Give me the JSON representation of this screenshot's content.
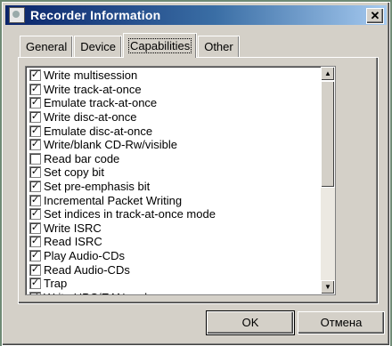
{
  "window": {
    "title": "Recorder Information",
    "close_label": "✕"
  },
  "tabs": [
    "General",
    "Device",
    "Capabilities",
    "Other"
  ],
  "active_tab": 2,
  "capabilities": [
    {
      "label": "Write multisession",
      "checked": true
    },
    {
      "label": "Write track-at-once",
      "checked": true
    },
    {
      "label": "Emulate track-at-once",
      "checked": true
    },
    {
      "label": "Write disc-at-once",
      "checked": true
    },
    {
      "label": "Emulate disc-at-once",
      "checked": true
    },
    {
      "label": "Write/blank CD-Rw/visible",
      "checked": true
    },
    {
      "label": "Read bar code",
      "checked": false
    },
    {
      "label": "Set copy bit",
      "checked": true
    },
    {
      "label": "Set pre-emphasis bit",
      "checked": true
    },
    {
      "label": "Incremental Packet Writing",
      "checked": true
    },
    {
      "label": "Set indices in track-at-once mode",
      "checked": true
    },
    {
      "label": "Write ISRC",
      "checked": true
    },
    {
      "label": "Read ISRC",
      "checked": true
    },
    {
      "label": "Play Audio-CDs",
      "checked": true
    },
    {
      "label": "Read Audio-CDs",
      "checked": true
    },
    {
      "label": "Trap",
      "checked": true
    },
    {
      "label": "Write UPC/EAN code",
      "checked": true
    }
  ],
  "buttons": {
    "ok": "OK",
    "cancel": "Отмена"
  },
  "icons": {
    "scroll_up": "▲",
    "scroll_down": "▼",
    "check": "✓"
  }
}
